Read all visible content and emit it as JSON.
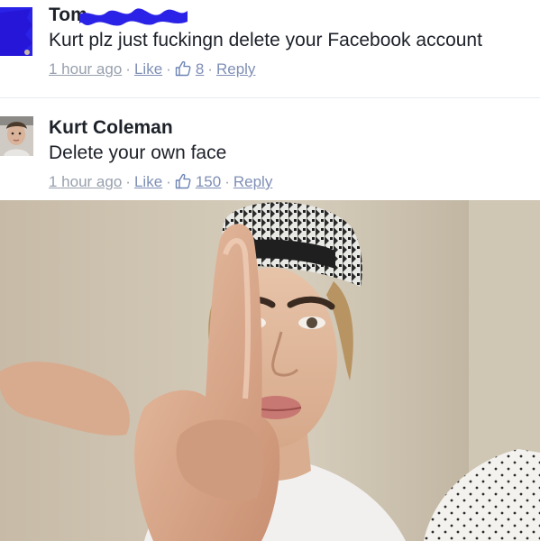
{
  "comments": [
    {
      "author": "Tom",
      "text": "Kurt plz just fuckingn delete your Facebook account",
      "time": "1 hour ago",
      "like_label": "Like",
      "like_count": "8",
      "reply_label": "Reply",
      "avatar_icon": "blue-scribbled-avatar",
      "redaction": "blue-scribble-icon"
    },
    {
      "author": "Kurt Coleman",
      "text": "Delete your own face",
      "time": "1 hour ago",
      "like_label": "Like",
      "like_count": "150",
      "reply_label": "Reply",
      "avatar_icon": "profile-avatar"
    }
  ],
  "colors": {
    "text": "#1d2129",
    "link": "#7f8fb5",
    "meta": "#98a0ad",
    "redaction_blue": "#2a22e6"
  },
  "photo": {
    "icon": "selfie-photo"
  }
}
